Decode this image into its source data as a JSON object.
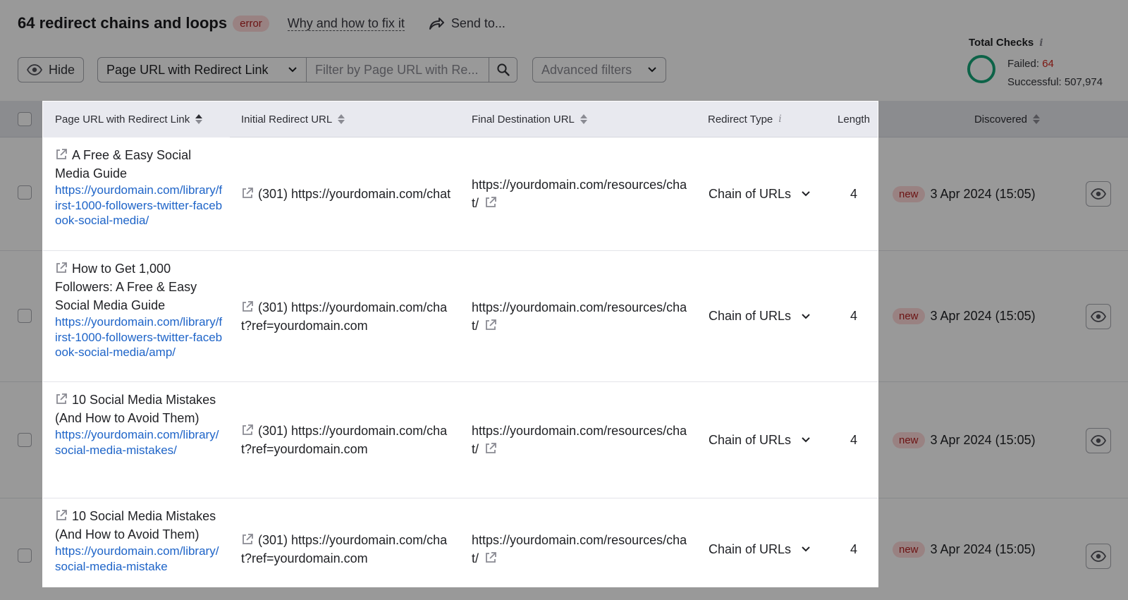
{
  "header": {
    "title": "64 redirect chains and loops",
    "badge": "error",
    "why_link": "Why and how to fix it",
    "send_label": "Send to..."
  },
  "filters": {
    "hide_label": "Hide",
    "column_select": "Page URL with Redirect Link",
    "filter_placeholder": "Filter by Page URL with Re...",
    "advanced_label": "Advanced filters"
  },
  "checks": {
    "title": "Total Checks",
    "failed_label": "Failed:",
    "failed_value": "64",
    "success_label": "Successful:",
    "success_value": "507,974"
  },
  "table": {
    "columns": {
      "page_url": "Page URL with Redirect Link",
      "initial": "Initial Redirect URL",
      "final": "Final Destination URL",
      "type": "Redirect Type",
      "length": "Length",
      "discovered": "Discovered"
    },
    "rows": [
      {
        "title": "A Free & Easy Social Media Guide",
        "url": "https://yourdomain.com/library/first-1000-followers-twitter-facebook-social-media/",
        "initial": "(301) https://yourdomain.com/chat",
        "final": "https://yourdomain.com/resources/chat/",
        "type": "Chain of URLs",
        "length": "4",
        "badge": "new",
        "date": "3 Apr 2024 (15:05)"
      },
      {
        "title": "How to Get 1,000 Followers: A Free & Easy Social Media Guide",
        "url": "https://yourdomain.com/library/first-1000-followers-twitter-facebook-social-media/amp/",
        "initial": "(301) https://yourdomain.com/chat?ref=yourdomain.com",
        "final": "https://yourdomain.com/resources/chat/",
        "type": "Chain of URLs",
        "length": "4",
        "badge": "new",
        "date": "3 Apr 2024 (15:05)"
      },
      {
        "title": "10 Social Media Mistakes (And How to Avoid Them)",
        "url": "https://yourdomain.com/library/social-media-mistakes/",
        "initial": "(301) https://yourdomain.com/chat?ref=yourdomain.com",
        "final": "https://yourdomain.com/resources/chat/",
        "type": "Chain of URLs",
        "length": "4",
        "badge": "new",
        "date": "3 Apr 2024 (15:05)"
      },
      {
        "title": "10 Social Media Mistakes (And How to Avoid Them)",
        "url": "https://yourdomain.com/library/social-media-mistake",
        "initial": "(301) https://yourdomain.com/chat?ref=yourdomain.com",
        "final": "https://yourdomain.com/resources/chat/",
        "type": "Chain of URLs",
        "length": "4",
        "badge": "new",
        "date": "3 Apr 2024 (15:05)"
      }
    ]
  }
}
